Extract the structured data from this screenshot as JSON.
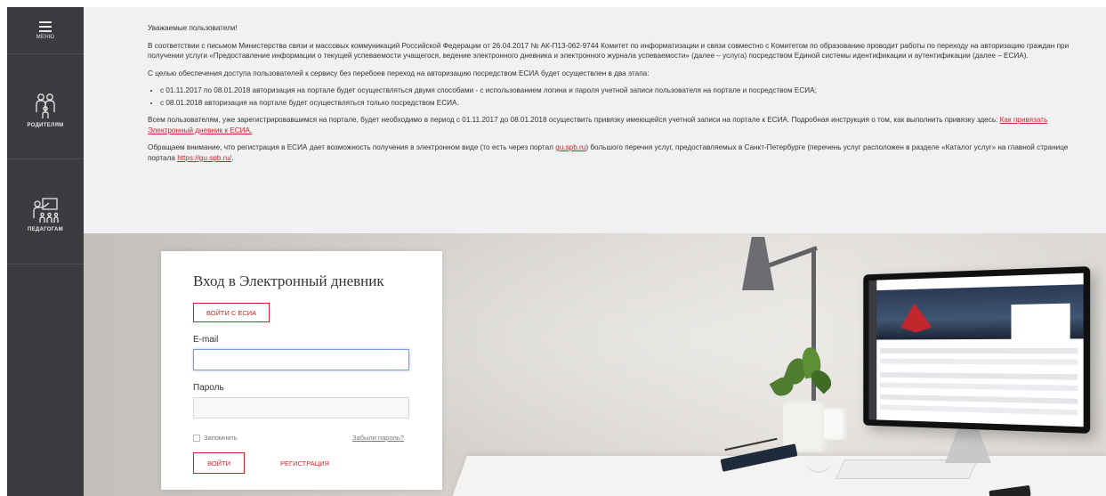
{
  "sidebar": {
    "menu_label": "МЕНЮ",
    "parents_label": "РОДИТЕЛЯМ",
    "teachers_label": "ПЕДАГОГАМ",
    "bg_color": "#3b3b40"
  },
  "notice": {
    "greeting": "Уважаемые пользователи!",
    "para1": "В соответствии с письмом Министерства связи и массовых коммуникаций Российской Федерации от 26.04.2017 № АК-П13-062-9744 Комитет по информатизации и связи совместно с Комитетом по образованию проводит работы по переходу на авторизацию граждан при получении услуги «Предоставление информации о текущей успеваемости учащегося, ведение электронного дневника и электронного журнала успеваемости» (далее – услуга) посредством Единой системы идентификации и аутентификации (далее – ЕСИА).",
    "para2": "С целью обеспечения доступа пользователей к сервису без перебоев переход на авторизацию посредством ЕСИА будет осуществлен в два этапа:",
    "bullet1": "с 01.11.2017 по 08.01.2018 авторизация на портале будет осуществляться двумя способами - с использованием логина и пароля учетной записи пользователя на портале и посредством ЕСИА;",
    "bullet2": "с 08.01.2018 авторизация на портале будет осуществляться только посредством ЕСИА.",
    "para3": "Всем пользователям, уже зарегистрировавшимся на портале, будет необходимо в период с 01.11.2017 до 08.01.2018 осуществить привязку имеющейся учетной записи на портале к ЕСИА. Подробная инструкция о том, как выполнить привязку здесь: ",
    "para3_link": "Как привязать Электронный дневник к ЕСИА.",
    "para4_a": "Обращаем внимание, что регистрация в ЕСИА дает возможность получения в электронном виде (то есть через портал ",
    "para4_link1": "gu.spb.ru",
    "para4_b": ") большого перечня услуг, предоставляемых в Санкт-Петербурге (перечень услуг расположен в разделе «Каталог услуг» на главной странице портала ",
    "para4_link2": "https://gu.spb.ru/",
    "para4_c": "."
  },
  "login": {
    "title": "Вход в Электронный дневник",
    "esia_button": "ВОЙТИ С ЕСИА",
    "email_label": "E-mail",
    "email_value": "",
    "password_label": "Пароль",
    "password_value": "",
    "remember_label": "Запомнить",
    "forgot_link": "Забыли пароль?",
    "login_button": "ВОЙТИ",
    "register_link": "РЕГИСТРАЦИЯ",
    "accent_color": "#c9252c"
  }
}
